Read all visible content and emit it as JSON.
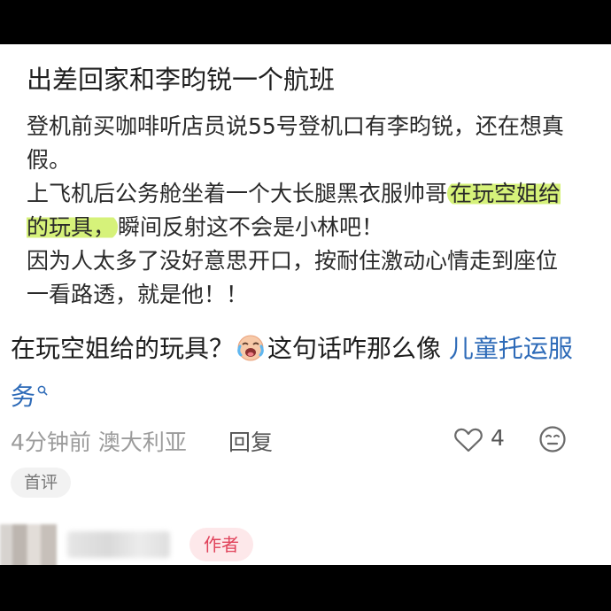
{
  "post": {
    "title": "出差回家和李昀锐一个航班",
    "body": {
      "p1": "登机前买咖啡听店员说55号登机口有李昀锐，还在想真假。",
      "p2_before": "上飞机后公务舱坐着一个大长腿黑衣服帅哥",
      "p2_highlight": "在玩空姐给的玩具，",
      "p2_after": "瞬间反射这不会是小林吧！",
      "p3": "因为人太多了没好意思开口，按耐住激动心情走到座位一看路透，就是他！！"
    }
  },
  "comment": {
    "text_before": "在玩空姐给的玩具？",
    "emoji": "crying-laughing-emoji",
    "text_after": "这句话咋那么像 ",
    "link": "儿童托运服务",
    "link_color": "#2e6bb8",
    "time": "4分钟前",
    "location": "澳大利亚",
    "reply_label": "回复",
    "like_count": "4",
    "first_badge": "首评"
  },
  "reply_preview": {
    "author_badge": "作者",
    "author_badge_color": "#e0425a"
  },
  "icons": {
    "like": "heart-outline-icon",
    "react": "neutral-face-icon",
    "search": "search-icon"
  }
}
